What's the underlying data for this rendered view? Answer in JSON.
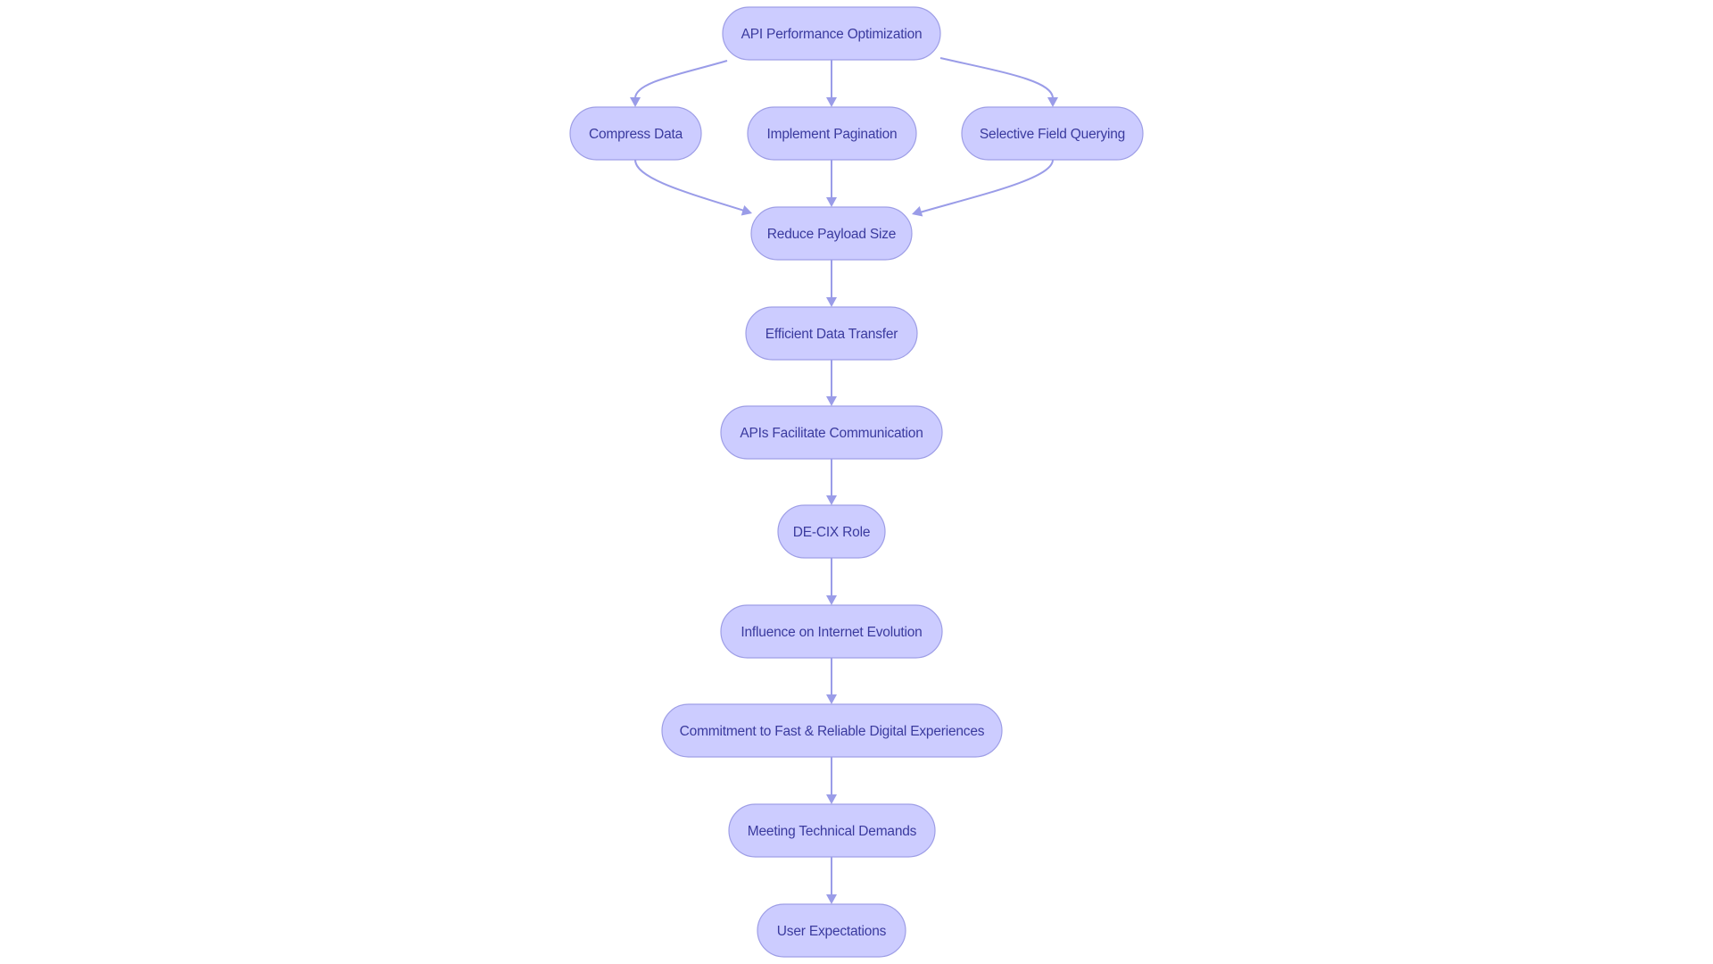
{
  "diagram": {
    "type": "flowchart",
    "direction": "top-down",
    "colors": {
      "node_fill": "#CCCCFF",
      "node_stroke": "#9E9EE6",
      "node_text": "#3A3A9E",
      "edge": "#9A9CE8",
      "background": "#FFFFFF"
    },
    "nodes": [
      {
        "id": "api_perf",
        "label": "API Performance Optimization"
      },
      {
        "id": "compress",
        "label": "Compress Data"
      },
      {
        "id": "pagination",
        "label": "Implement Pagination"
      },
      {
        "id": "selective",
        "label": "Selective Field Querying"
      },
      {
        "id": "reduce",
        "label": "Reduce Payload Size"
      },
      {
        "id": "efficient",
        "label": "Efficient Data Transfer"
      },
      {
        "id": "apis_comm",
        "label": "APIs Facilitate Communication"
      },
      {
        "id": "decix",
        "label": "DE-CIX Role"
      },
      {
        "id": "influence",
        "label": "Influence on Internet Evolution"
      },
      {
        "id": "commitment",
        "label": "Commitment to Fast & Reliable Digital Experiences"
      },
      {
        "id": "meeting",
        "label": "Meeting Technical Demands"
      },
      {
        "id": "user_exp",
        "label": "User Expectations"
      }
    ],
    "edges": [
      {
        "from": "api_perf",
        "to": "compress"
      },
      {
        "from": "api_perf",
        "to": "pagination"
      },
      {
        "from": "api_perf",
        "to": "selective"
      },
      {
        "from": "compress",
        "to": "reduce"
      },
      {
        "from": "pagination",
        "to": "reduce"
      },
      {
        "from": "selective",
        "to": "reduce"
      },
      {
        "from": "reduce",
        "to": "efficient"
      },
      {
        "from": "efficient",
        "to": "apis_comm"
      },
      {
        "from": "apis_comm",
        "to": "decix"
      },
      {
        "from": "decix",
        "to": "influence"
      },
      {
        "from": "influence",
        "to": "commitment"
      },
      {
        "from": "commitment",
        "to": "meeting"
      },
      {
        "from": "meeting",
        "to": "user_exp"
      }
    ]
  }
}
